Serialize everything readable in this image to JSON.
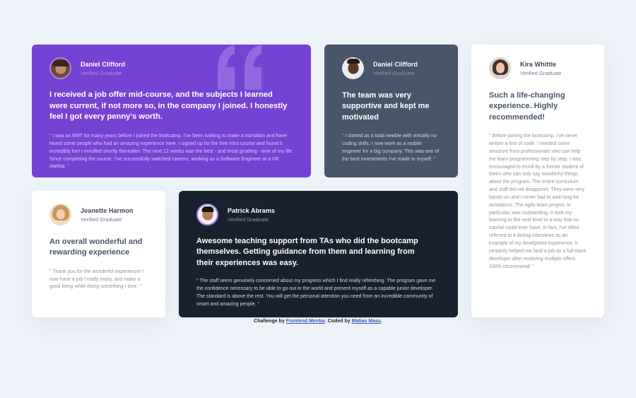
{
  "testimonials": [
    {
      "name": "Daniel Clifford",
      "status": "Verified Graduate",
      "headline": "I received a job offer mid-course, and the subjects I learned were current, if not more so, in the company I joined. I honestly feel I got every penny's worth.",
      "quote": "“ I was an EMT for many years before I joined the bootcamp. I've been looking to make a transition and have heard some people who had an amazing experience here. I signed up for the free intro course and found it incredibly fun! I enrolled shortly thereafter. The next 12 weeks was the best - and most grueling - time of my life. Since completing the course, I've successfully switched careers, working as a Software Engineer at a VR startup. ”"
    },
    {
      "name": "Daniel Clifford",
      "status": "Verified Graduate",
      "headline": "The team was very supportive and kept me motivated",
      "quote": "“ I started as a total newbie with virtually no coding skills. I now work as a mobile engineer for a big company. This was one of the best investments I've made in myself. ”"
    },
    {
      "name": "Kira Whittle",
      "status": "Verified Graduate",
      "headline": "Such a life-changing experience. Highly recommended!",
      "quote": "“ Before joining the bootcamp, I've never written a line of code. I needed some structure from professionals who can help me learn programming step by step. I was encouraged to enroll by a former student of theirs who can only say wonderful things about the program. The entire curriculum and staff did not disappoint. They were very hands-on and I never had to wait long for assistance. The agile team project, in particular, was outstanding. It took my learning to the next level in a way that no tutorial could ever have. In fact, I've often referred to it during interviews as an example of my develpoent experience. It certainly helped me land a job as a full-stack developer after receiving multiple offers. 100% recommend! ”"
    },
    {
      "name": "Jeanette Harmon",
      "status": "Verified Graduate",
      "headline": "An overall wonderful and rewarding experience",
      "quote": "“ Thank you for the wonderful experience! I now have a job I really enjoy, and make a good living while doing something I love. ”"
    },
    {
      "name": "Patrick Abrams",
      "status": "Verified Graduate",
      "headline": "Awesome teaching support from TAs who did the bootcamp themselves. Getting guidance from them and learning from their experiences was easy.",
      "quote": "“ The staff seem genuinely concerned about my progress which I find really refreshing. The program gave me the confidence necessary to be able to go out in the world and present myself as a capable junior developer. The standard is above the rest. You will get the personal attention you need from an incredible community of smart and amazing people. ”"
    }
  ],
  "attribution": {
    "prefix": "Challenge by",
    "link1": "Frontend Mentor",
    "middle": ". Coded by",
    "link2": "Matias Mass",
    "suffix": "."
  },
  "colors": {
    "purple": "#7543d3",
    "slate": "#48556a",
    "dark": "#19212e",
    "background": "#edf2f8"
  }
}
